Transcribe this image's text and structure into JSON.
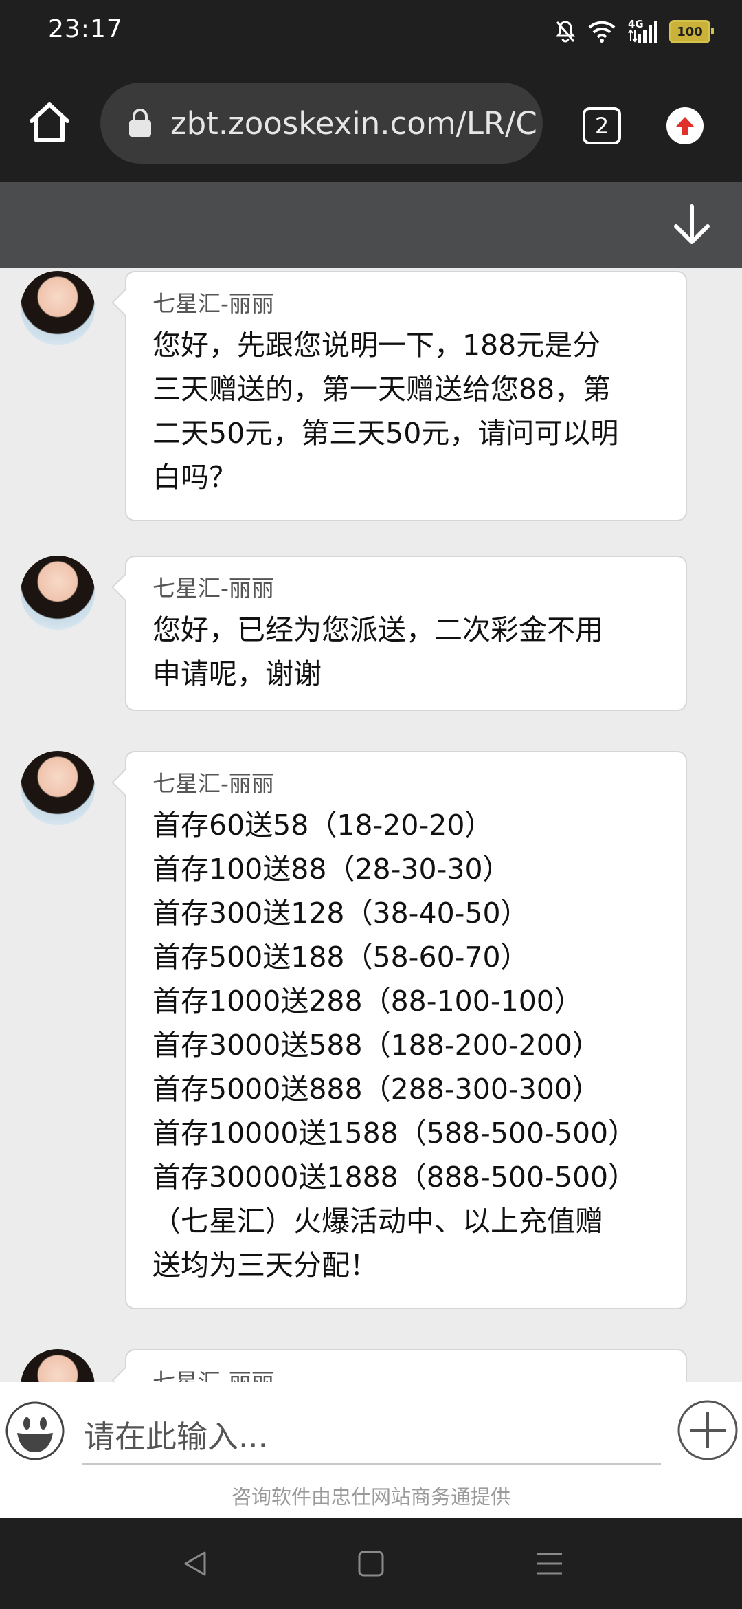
{
  "status_bar": {
    "time": "23:17",
    "network": "4G",
    "battery": "100"
  },
  "browser": {
    "url": "zbt.zooskexin.com/LR/C",
    "tab_count": "2"
  },
  "messages": [
    {
      "sender": "七星汇-丽丽",
      "text": "您好，先跟您说明一下，188元是分\n三天赠送的，第一天赠送给您88，第\n二天50元，第三天50元，请问可以明\n白吗？"
    },
    {
      "sender": "七星汇-丽丽",
      "text": "您好，已经为您派送，二次彩金不用\n申请呢，谢谢"
    },
    {
      "sender": "七星汇-丽丽",
      "text": "首存60送58（18-20-20）\n首存100送88（28-30-30）\n首存300送128（38-40-50）\n首存500送188（58-60-70）\n首存1000送288（88-100-100）\n首存3000送588（188-200-200）\n首存5000送888（288-300-300）\n首存10000送1588（588-500-500）\n首存30000送1888（888-500-500）\n（七星汇）火爆活动中、以上充值赠\n送均为三天分配！"
    },
    {
      "sender": "七星汇-丽丽",
      "text": ""
    }
  ],
  "input": {
    "placeholder": "请在此输入..."
  },
  "footer": {
    "credit": "咨询软件由忠仕网站商务通提供"
  }
}
